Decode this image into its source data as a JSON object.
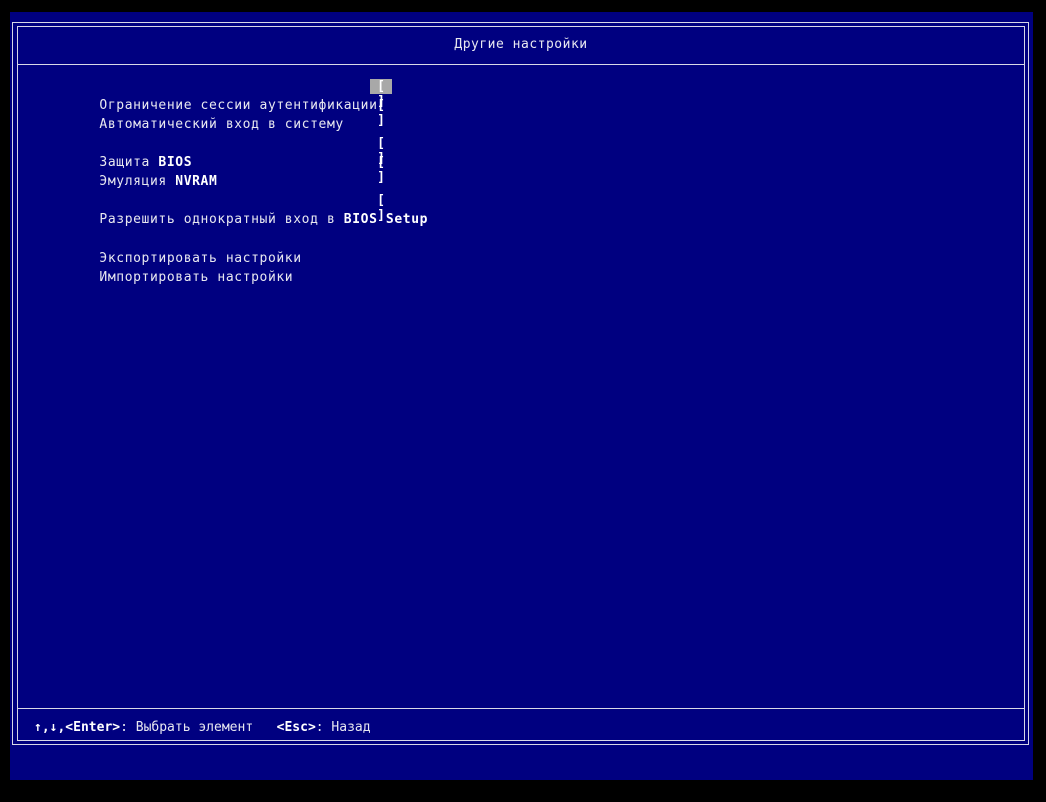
{
  "title": "Другие настройки",
  "items": [
    {
      "label": "Ограничение сессии аутентификации",
      "checkbox": "[ ]",
      "selected": true
    },
    {
      "label": "Автоматический вход в систему",
      "checkbox": "[ ]"
    },
    {
      "label_prefix": "Защита ",
      "label_bold": "BIOS",
      "checkbox": "[ ]"
    },
    {
      "label_prefix": "Эмуляция ",
      "label_bold": "NVRAM",
      "checkbox": "[ ]"
    },
    {
      "label_prefix": "Разрешить однократный вход в ",
      "label_bold": "BIOS Setup",
      "checkbox": "[ ]"
    },
    {
      "label": "Экспортировать настройки"
    },
    {
      "label": "Импортировать настройки"
    }
  ],
  "footer": {
    "keys1": "↑,↓,<Enter>",
    "action1": ": Выбрать элемент",
    "keys2": "<Esc>",
    "action2": ": Назад"
  },
  "colors": {
    "background": "#000080",
    "text": "#e8e8f0",
    "highlight": "#a8a8a8",
    "border": "#d8d8e8"
  }
}
